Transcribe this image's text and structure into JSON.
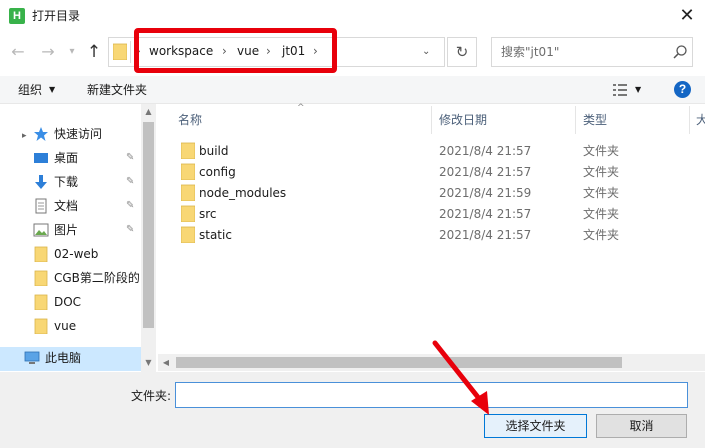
{
  "window": {
    "title": "打开目录",
    "app_icon_letter": "H",
    "close_glyph": "✕"
  },
  "nav": {
    "back_glyph": "←",
    "forward_glyph": "→",
    "recent_glyph": "▾",
    "up_glyph": "↑"
  },
  "address": {
    "crumbs": [
      "workspace",
      "vue",
      "jt01"
    ],
    "separator": "›",
    "dropdown_glyph": "⌄",
    "refresh_glyph": "↻"
  },
  "search": {
    "placeholder": "搜索\"jt01\""
  },
  "toolbar": {
    "organize_label": "组织",
    "organize_caret": "▼",
    "new_folder_label": "新建文件夹",
    "view_caret": "▼",
    "help_label": "?"
  },
  "sidebar": {
    "quick_access_label": "快速访问",
    "items": [
      {
        "label": "桌面",
        "icon": "desktop-icon",
        "pinned": true
      },
      {
        "label": "下载",
        "icon": "download-icon",
        "pinned": true
      },
      {
        "label": "文档",
        "icon": "document-icon",
        "pinned": true
      },
      {
        "label": "图片",
        "icon": "picture-icon",
        "pinned": true
      },
      {
        "label": "02-web",
        "icon": "folder-icon",
        "pinned": false
      },
      {
        "label": "CGB第二阶段的",
        "icon": "folder-icon",
        "pinned": false
      },
      {
        "label": "DOC",
        "icon": "folder-icon",
        "pinned": false
      },
      {
        "label": "vue",
        "icon": "folder-icon",
        "pinned": false
      }
    ],
    "this_pc_label": "此电脑",
    "pin_glyph": "📌",
    "collapse_glyph": "▸"
  },
  "file_list": {
    "columns": {
      "name": "名称",
      "date": "修改日期",
      "type": "类型",
      "extra": "大"
    },
    "sort_glyph": "^",
    "rows": [
      {
        "name": "build",
        "date": "2021/8/4 21:57",
        "type": "文件夹"
      },
      {
        "name": "config",
        "date": "2021/8/4 21:57",
        "type": "文件夹"
      },
      {
        "name": "node_modules",
        "date": "2021/8/4 21:59",
        "type": "文件夹"
      },
      {
        "name": "src",
        "date": "2021/8/4 21:57",
        "type": "文件夹"
      },
      {
        "name": "static",
        "date": "2021/8/4 21:57",
        "type": "文件夹"
      }
    ]
  },
  "bottom": {
    "folder_label": "文件夹:",
    "folder_value": "",
    "select_label": "选择文件夹",
    "cancel_label": "取消"
  },
  "colors": {
    "highlight": "#e8000b",
    "folder_yellow": "#f8d775",
    "selected_bg": "#cce8ff",
    "accent": "#0078d7"
  }
}
